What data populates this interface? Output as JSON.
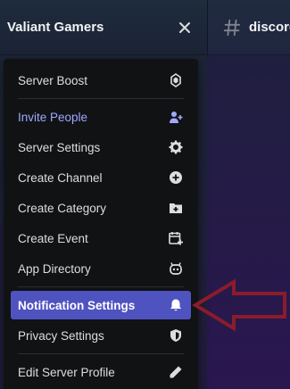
{
  "server": {
    "name": "Valiant Gamers"
  },
  "channel": {
    "name": "discord"
  },
  "menu": {
    "items": [
      {
        "label": "Server Boost",
        "icon": "boost-icon"
      },
      {
        "label": "Invite People",
        "icon": "add-user-icon"
      },
      {
        "label": "Server Settings",
        "icon": "gear-icon"
      },
      {
        "label": "Create Channel",
        "icon": "plus-circle-icon"
      },
      {
        "label": "Create Category",
        "icon": "folder-plus-icon"
      },
      {
        "label": "Create Event",
        "icon": "calendar-plus-icon"
      },
      {
        "label": "App Directory",
        "icon": "robot-icon"
      },
      {
        "label": "Notification Settings",
        "icon": "bell-icon",
        "selected": true
      },
      {
        "label": "Privacy Settings",
        "icon": "shield-icon"
      },
      {
        "label": "Edit Server Profile",
        "icon": "pencil-icon"
      }
    ]
  },
  "colors": {
    "accent": "#a0a8ff",
    "selected_bg": "#4f53c0",
    "arrow": "#8a1c2b"
  }
}
